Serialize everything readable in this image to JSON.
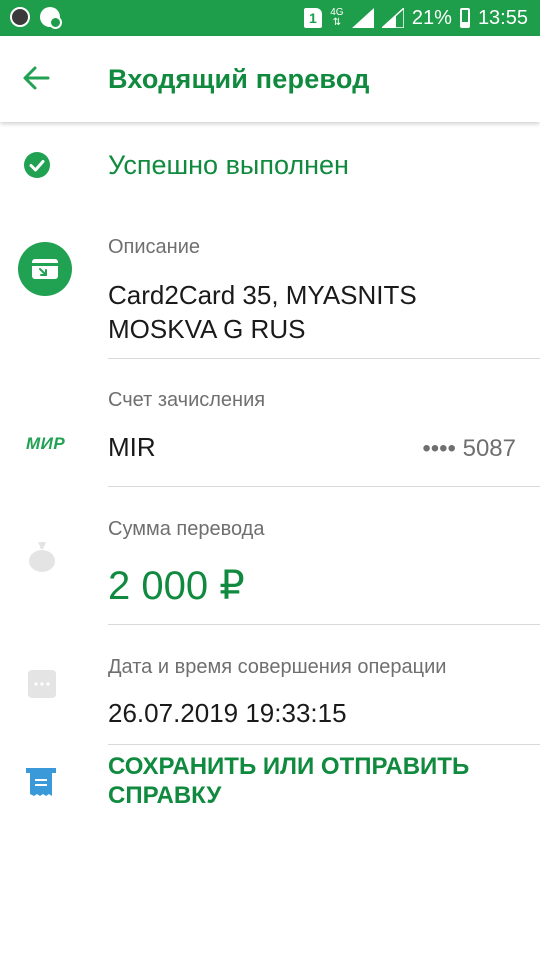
{
  "status_bar": {
    "sim_label": "1",
    "network": "4G",
    "battery_percent": "21%",
    "time": "13:55"
  },
  "header": {
    "title": "Входящий перевод"
  },
  "transfer_status": {
    "text": "Успешно выполнен"
  },
  "description": {
    "label": "Описание",
    "line1": "Card2Card 35, MYASNITS",
    "line2": "MOSKVA G RUS"
  },
  "account": {
    "label": "Счет зачисления",
    "logo_text": "МИР",
    "card_name": "MIR",
    "card_number": "•••• 5087"
  },
  "amount": {
    "label": "Сумма перевода",
    "value": "2 000 ₽"
  },
  "datetime": {
    "label": "Дата и время совершения операции",
    "value": "26.07.2019 19:33:15"
  },
  "action": {
    "line1": "СОХРАНИТЬ ИЛИ ОТПРАВИТЬ",
    "line2": "СПРАВКУ"
  },
  "colors": {
    "brand_green": "#108a3e",
    "status_bar_green": "#1e9e4a",
    "icon_green": "#21a152",
    "icon_grey": "#e4e4e4",
    "receipt_blue": "#3a9ad9"
  }
}
